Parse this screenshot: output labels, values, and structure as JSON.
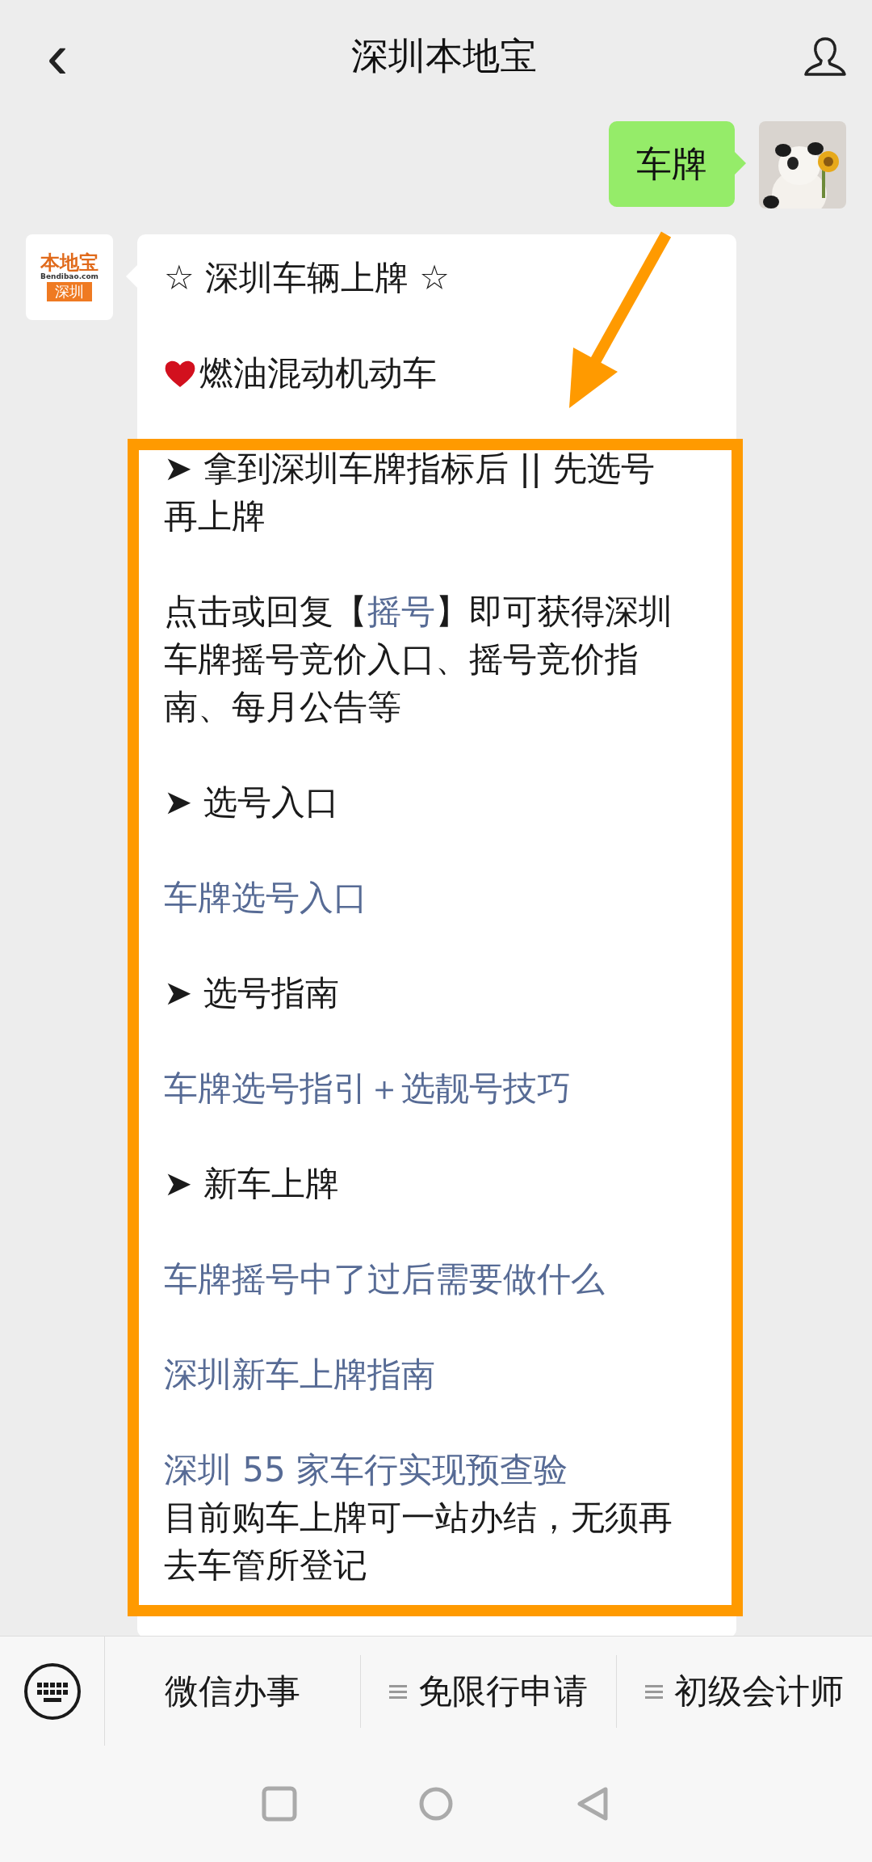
{
  "header": {
    "back": "‹",
    "title": "深圳本地宝"
  },
  "sent": {
    "text": "车牌"
  },
  "bot_logo": {
    "top": "本地宝",
    "site": "Bendibao.com",
    "city": "深圳"
  },
  "message": {
    "blocks": [
      {
        "lines": [
          {
            "kind": "text",
            "text": "☆ 深圳车辆上牌 ☆"
          }
        ]
      },
      {
        "lines": [
          {
            "kind": "heart",
            "text": "燃油混动机动车"
          }
        ]
      },
      {
        "lines": [
          {
            "kind": "heading",
            "marker": "➤",
            "text": "拿到深圳车牌指标后 || 先选号再上牌"
          }
        ]
      },
      {
        "lines": [
          {
            "kind": "mixed",
            "parts": [
              {
                "text": "点击或回复【",
                "link": false
              },
              {
                "text": "摇号",
                "link": true
              },
              {
                "text": "】即可获得深圳车牌摇号竞价入口、摇号竞价指南、每月公告等",
                "link": false
              }
            ]
          }
        ]
      },
      {
        "lines": [
          {
            "kind": "heading",
            "marker": "➤",
            "text": "选号入口"
          }
        ]
      },
      {
        "lines": [
          {
            "kind": "link",
            "text": "车牌选号入口"
          }
        ]
      },
      {
        "lines": [
          {
            "kind": "heading",
            "marker": "➤",
            "text": "选号指南"
          }
        ]
      },
      {
        "lines": [
          {
            "kind": "link",
            "text": "车牌选号指引＋选靓号技巧"
          }
        ]
      },
      {
        "lines": [
          {
            "kind": "heading",
            "marker": "➤",
            "text": "新车上牌"
          }
        ]
      },
      {
        "lines": [
          {
            "kind": "link",
            "text": "车牌摇号中了过后需要做什么"
          }
        ]
      },
      {
        "lines": [
          {
            "kind": "link",
            "text": "深圳新车上牌指南"
          }
        ]
      },
      {
        "lines": [
          {
            "kind": "link",
            "text": "深圳 55 家车行实现预查验"
          },
          {
            "kind": "text",
            "text": "目前购车上牌可一站办结，无须再去车管所登记"
          }
        ]
      }
    ]
  },
  "menu": [
    {
      "label": "微信办事",
      "submenu": false
    },
    {
      "label": "免限行申请",
      "submenu": true
    },
    {
      "label": "初级会计师",
      "submenu": true
    }
  ]
}
